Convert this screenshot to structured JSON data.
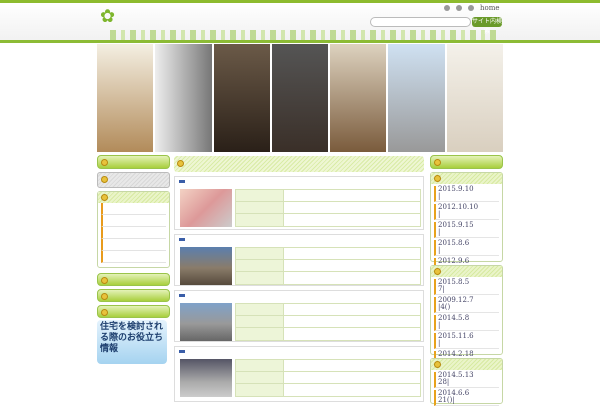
{
  "header": {
    "home_link": "home",
    "search_placeholder": "",
    "search_button": "サイト内検索"
  },
  "banner": {
    "text": "住宅を検討される際のお役立ち情報"
  },
  "right": {
    "box1": [
      "2015.9.10",
      "2012.10.10",
      "2015.9.15",
      "2015.8.6",
      "2012.9.6"
    ],
    "box1_sub": [
      "|",
      "|",
      "|",
      "|",
      ""
    ],
    "box2": [
      "2015.8.5",
      "2009.12.7",
      "2014.5.8",
      "2015.11.6",
      "2014.2.18"
    ],
    "box2_sub": [
      "7|",
      "|4()",
      "|",
      "|",
      ""
    ],
    "box3": [
      "2014.5.13",
      "2014.6.6"
    ],
    "box3_sub": [
      "28|",
      "21()|"
    ]
  }
}
